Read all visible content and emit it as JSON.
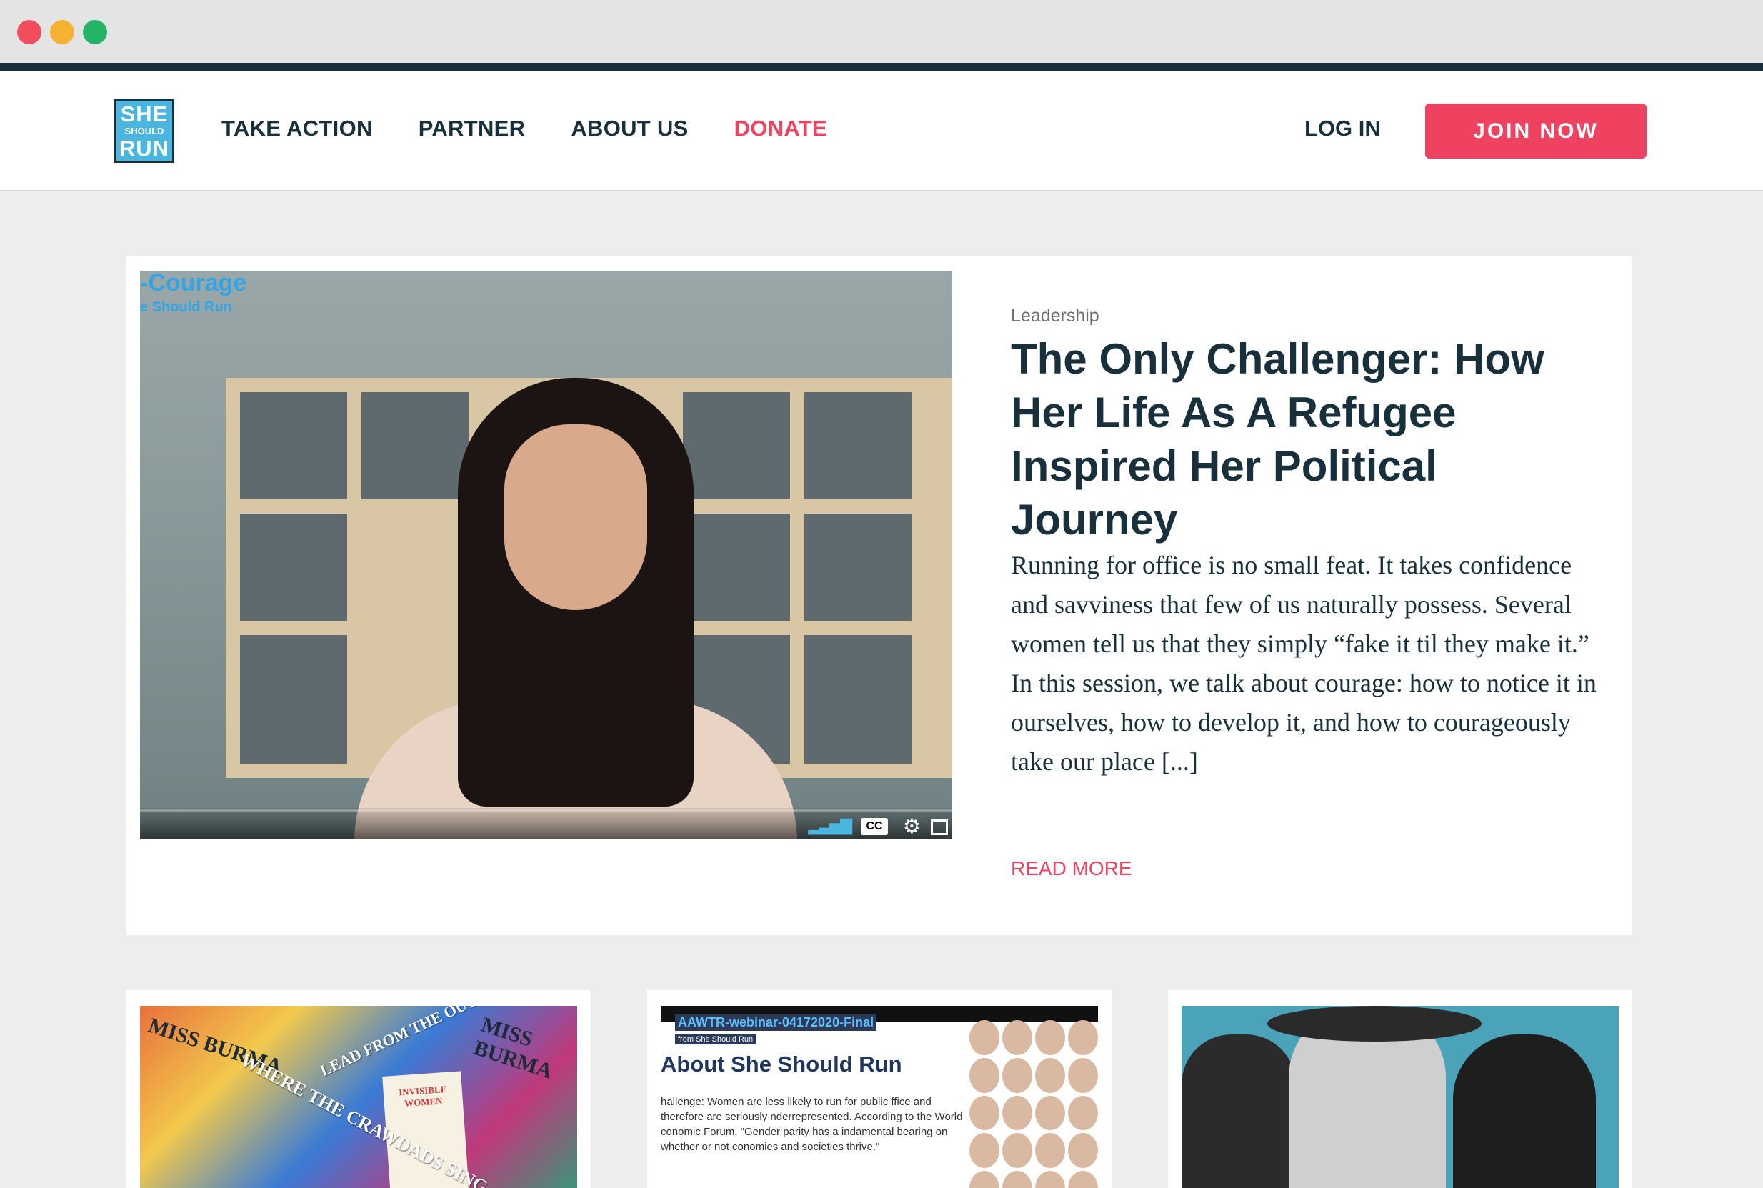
{
  "logo": {
    "line1": "SHE",
    "line2": "SHOULD",
    "line3": "RUN"
  },
  "nav": {
    "items": [
      "TAKE ACTION",
      "PARTNER",
      "ABOUT US"
    ],
    "donate": "DONATE",
    "login": "LOG IN",
    "join": "JOIN NOW"
  },
  "colors": {
    "accent": "#ef4160",
    "navy": "#18303b",
    "brand_blue": "#4ab6e0"
  },
  "featured": {
    "video_title": "-Courage",
    "video_subtitle": "e Should Run",
    "cc_label": "CC",
    "category": "Leadership",
    "headline": "The Only Challenger: How Her Life As A Refugee Inspired Her Political Journey",
    "excerpt": "Running for office is no small feat. It takes confidence and savviness that few of us naturally possess. Several women tell us that they simply “fake it til they make it.” In this session, we talk about courage: how to notice it in ourselves, how to develop it, and how to courageously take our place [...]",
    "read_more": "READ MORE"
  },
  "cards": [
    {
      "books": [
        "MISS BURMA",
        "LEAD FROM THE OUTSIDE",
        "INVISIBLE WOMEN",
        "MISS BURMA",
        "WHERE THE CRAWDADS SING"
      ]
    },
    {
      "video_tag": "AAWTR-webinar-04172020-Final",
      "from_tag": "from She Should Run",
      "heading": "About She Should Run",
      "body": "hallenge: Women are less likely to run for public ffice and therefore are seriously nderrepresented. According to the World conomic Forum, \"Gender parity has a indamental bearing on whether or not conomies and societies thrive.\""
    },
    {}
  ]
}
